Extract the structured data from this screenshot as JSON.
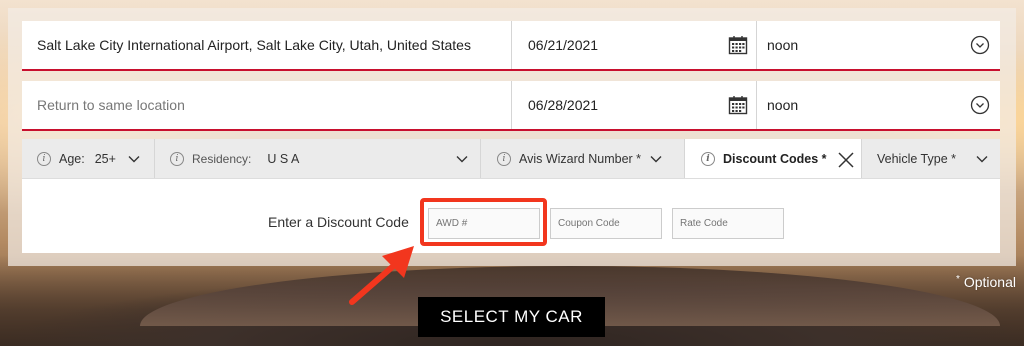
{
  "pickup": {
    "location": "Salt Lake City International Airport, Salt Lake City, Utah, United States",
    "date": "06/21/2021",
    "time": "noon"
  },
  "return": {
    "location_placeholder": "Return to same location",
    "date": "06/28/2021",
    "time": "noon"
  },
  "tabs": {
    "age_label": "Age:",
    "age_value": "25+",
    "residency_label": "Residency:",
    "residency_value": "U S A",
    "wizard_label": "Avis Wizard Number *",
    "discount_label": "Discount Codes *",
    "vehicle_label": "Vehicle Type *"
  },
  "discount": {
    "prompt": "Enter a Discount Code",
    "awd_placeholder": "AWD #",
    "coupon_placeholder": "Coupon Code",
    "rate_placeholder": "Rate Code"
  },
  "optional_note": "Optional",
  "optional_star": "*",
  "select_button": "SELECT MY CAR",
  "colors": {
    "accent_red": "#c8102e",
    "highlight": "#f2361e",
    "button_bg": "#000000"
  }
}
